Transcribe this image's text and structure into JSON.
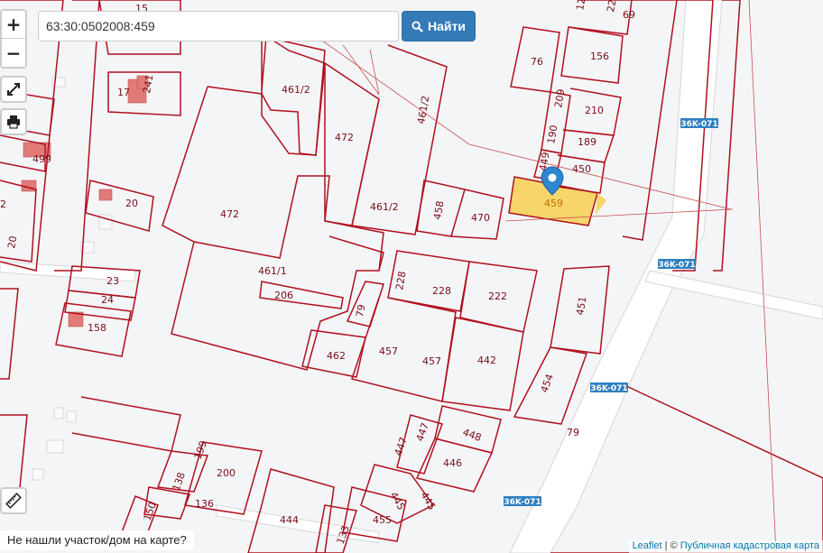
{
  "search": {
    "value": "63:30:0502008:459",
    "button_label": "Найти"
  },
  "zoom": {
    "in": "+",
    "out": "−"
  },
  "icons": {
    "fullscreen": "expand-icon",
    "print": "printer-icon",
    "measure": "ruler-icon",
    "search": "search-icon",
    "marker": "map-marker-icon"
  },
  "colors": {
    "parcel_border": "#b0101e",
    "selected_fill": "#f7d56a",
    "button": "#337ab7",
    "road_shield": "#2f7fc1"
  },
  "selected_parcel": "459",
  "parcels": [
    "15",
    "12",
    "22",
    "69",
    "76",
    "156",
    "209",
    "210",
    "17",
    "241",
    "461/2",
    "472",
    "461/2",
    "190",
    "189",
    "449",
    "450",
    "499",
    "472",
    "458",
    "470",
    "461/2",
    "20",
    "2",
    "20",
    "461/1",
    "228",
    "228",
    "222",
    "206",
    "23",
    "24",
    "79",
    "158",
    "451",
    "462",
    "457",
    "457",
    "442",
    "454",
    "448",
    "79",
    "447",
    "447",
    "446",
    "199",
    "200",
    "138",
    "445",
    "445",
    "136",
    "150",
    "444",
    "455",
    "133"
  ],
  "road_shields": [
    "36K-071",
    "36K-071",
    "36K-071",
    "36K-071"
  ],
  "not_found_text": "Не нашли участок/дом на карте?",
  "attribution": {
    "leaflet": "Leaflet",
    "sep": "| ©",
    "source": "Публичная кадастровая карта"
  }
}
